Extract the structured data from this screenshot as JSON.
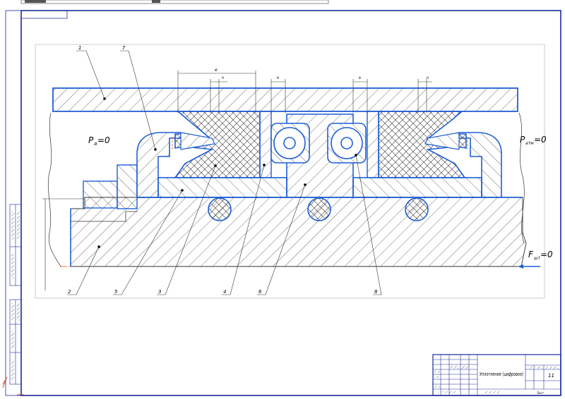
{
  "callouts": [
    {
      "id": "leader-1",
      "text": "1"
    },
    {
      "id": "leader-7",
      "text": "7"
    },
    {
      "id": "leader-2",
      "text": "2"
    },
    {
      "id": "leader-5",
      "text": "5"
    },
    {
      "id": "leader-3",
      "text": "3"
    },
    {
      "id": "leader-4",
      "text": "4"
    },
    {
      "id": "leader-6",
      "text": "6"
    },
    {
      "id": "leader-8",
      "text": "8"
    }
  ],
  "labels": {
    "pressure_left": "P",
    "pressure_left_sub": "a",
    "pressure_left_value": "=0",
    "pressure_right": "P",
    "pressure_right_sub": "атм",
    "pressure_right_value": "=0",
    "force": "F",
    "force_sub": "шт",
    "force_value": "=0"
  },
  "dimensions": {
    "dim_main": "e",
    "dim_h1": "h",
    "dim_b1": "b",
    "dim_b2": "b",
    "dim_h2": "h"
  },
  "title_block": {
    "title": "Уплотнение (цифровое)",
    "sheet_label": "Лист",
    "sheets": "11"
  },
  "colors": {
    "contour": "#1f5fd6",
    "hatch": "#333333",
    "axis": "#e07030",
    "frame": "#1a2a9a"
  }
}
